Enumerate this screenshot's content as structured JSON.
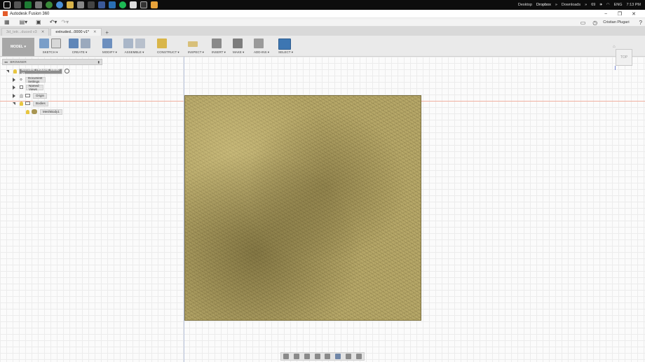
{
  "taskbar": {
    "tray": {
      "desktop": "Desktop",
      "dropbox": "Dropbox",
      "downloads": "Downloads",
      "battery": "69",
      "language": "ENG",
      "time": "7:13 PM"
    }
  },
  "titlebar": {
    "title": "Autodesk Fusion 360"
  },
  "qab": {
    "user": "Cristian Plugari"
  },
  "tabs": [
    {
      "label": "3d_tetr...duced v3"
    },
    {
      "label": "extruded...0000 v1*"
    }
  ],
  "toolbar": {
    "workspace": "MODEL",
    "groups": [
      {
        "label": "SKETCH"
      },
      {
        "label": "CREATE"
      },
      {
        "label": "MODIFY"
      },
      {
        "label": "ASSEMBLE"
      },
      {
        "label": "CONSTRUCT"
      },
      {
        "label": "INSPECT"
      },
      {
        "label": "INSERT"
      },
      {
        "label": "MAKE"
      },
      {
        "label": "ADD-INS"
      },
      {
        "label": "SELECT"
      }
    ]
  },
  "browser": {
    "header": "BROWSER",
    "root": "extruded_reduced_50000 v1",
    "items": {
      "doc_settings": "Document Settings",
      "named_views": "Named Views",
      "origin": "Origin",
      "bodies": "Bodies",
      "mesh_body": "MeshBody1"
    }
  },
  "viewcube": {
    "face": "TOP"
  }
}
